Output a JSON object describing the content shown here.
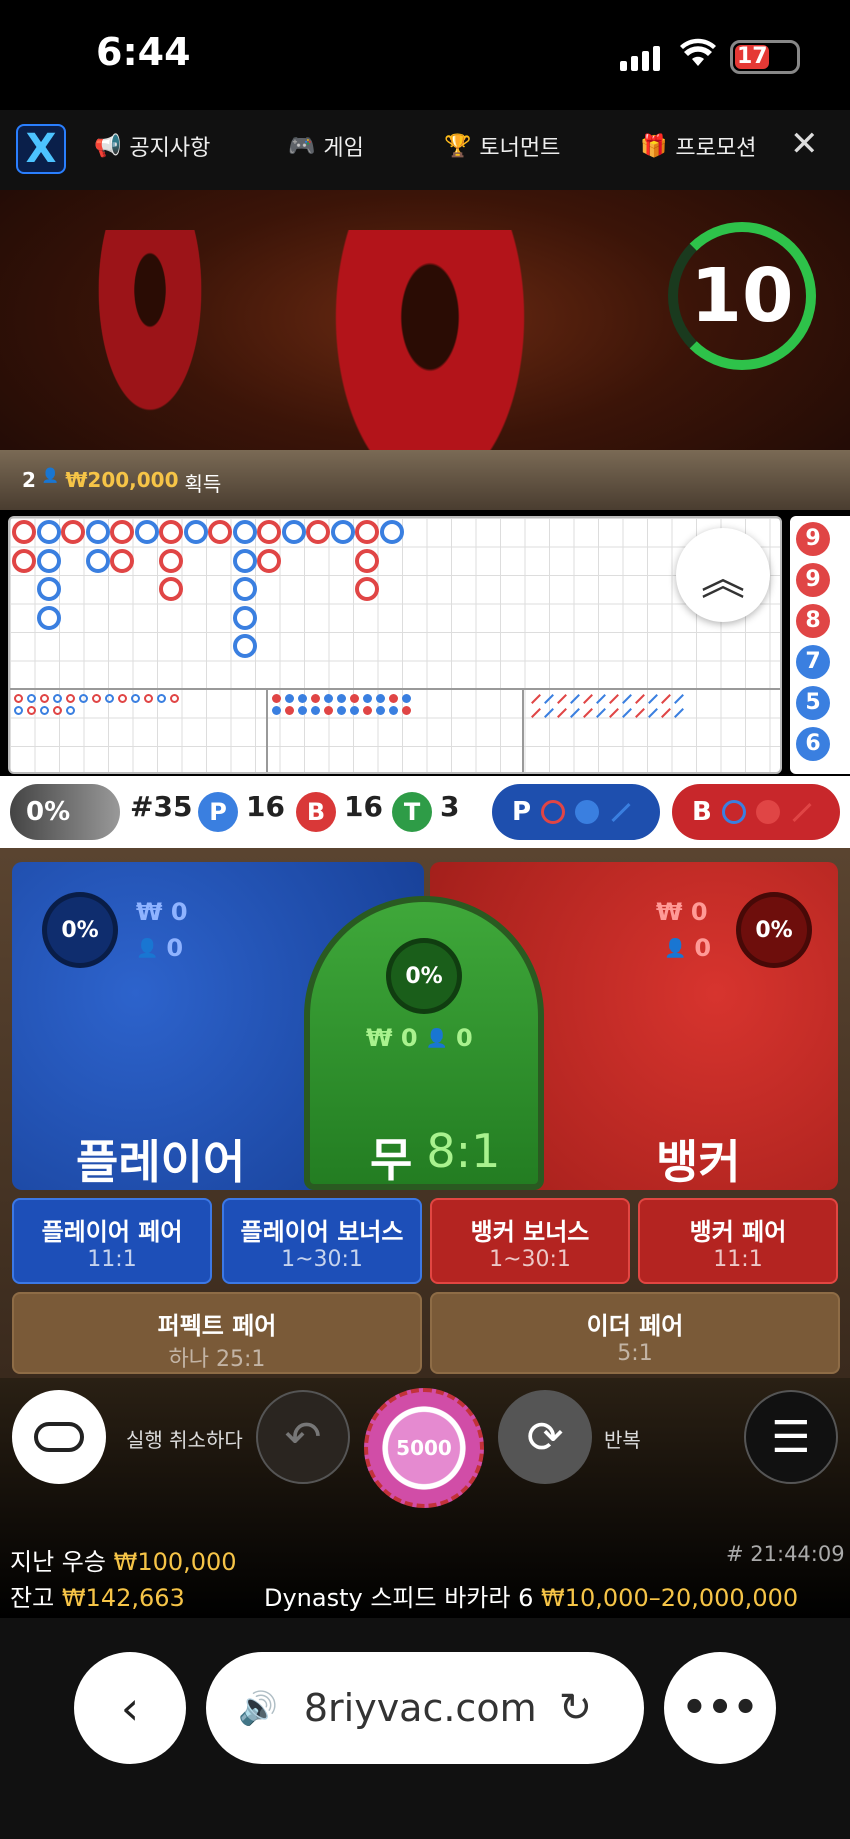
{
  "status": {
    "time": "6:44",
    "battery": "17"
  },
  "nav": {
    "items": [
      "공지사항",
      "게임",
      "토너먼트",
      "프로모션"
    ]
  },
  "video": {
    "timer": "10",
    "winners_count": "2",
    "win_amount": "₩200,000",
    "win_suffix": "획득"
  },
  "roadmap": {
    "side_numbers": [
      "9",
      "9",
      "8",
      "7",
      "5",
      "6"
    ]
  },
  "stats": {
    "percent": "0%",
    "round": "#35",
    "player_letter": "P",
    "player_count": "16",
    "banker_letter": "B",
    "banker_count": "16",
    "tie_letter": "T",
    "tie_count": "3",
    "ask_player": "P",
    "ask_banker": "B"
  },
  "bets": {
    "player": {
      "percent": "0%",
      "amount": "₩ 0",
      "users": "0",
      "label": "플레이어"
    },
    "tie": {
      "percent": "0%",
      "amount": "₩ 0",
      "users": "0",
      "label": "무",
      "odds": "8:1"
    },
    "banker": {
      "percent": "0%",
      "amount": "₩ 0",
      "users": "0",
      "label": "뱅커"
    },
    "side": [
      {
        "label": "플레이어 페어",
        "odds": "11:1"
      },
      {
        "label": "플레이어 보너스",
        "odds": "1~30:1"
      },
      {
        "label": "뱅커 보너스",
        "odds": "1~30:1"
      },
      {
        "label": "뱅커 페어",
        "odds": "11:1"
      }
    ],
    "pairs": [
      {
        "label": "퍼펙트 페어",
        "odds": "하나 25:1"
      },
      {
        "label": "이더 페어",
        "odds": "5:1"
      }
    ]
  },
  "controls": {
    "undo_label": "실행 취소하다",
    "chip_value": "5000",
    "repeat_label": "반복"
  },
  "footer": {
    "last_win_label": "지난 우승",
    "last_win": "₩100,000",
    "round_id": "# 21:44:09",
    "balance_label": "잔고",
    "balance": "₩142,663",
    "table_name": "Dynasty 스피드 바카라 6",
    "limits": "₩10,000–20,000,000"
  },
  "browser": {
    "url": "8riyvac.com"
  }
}
